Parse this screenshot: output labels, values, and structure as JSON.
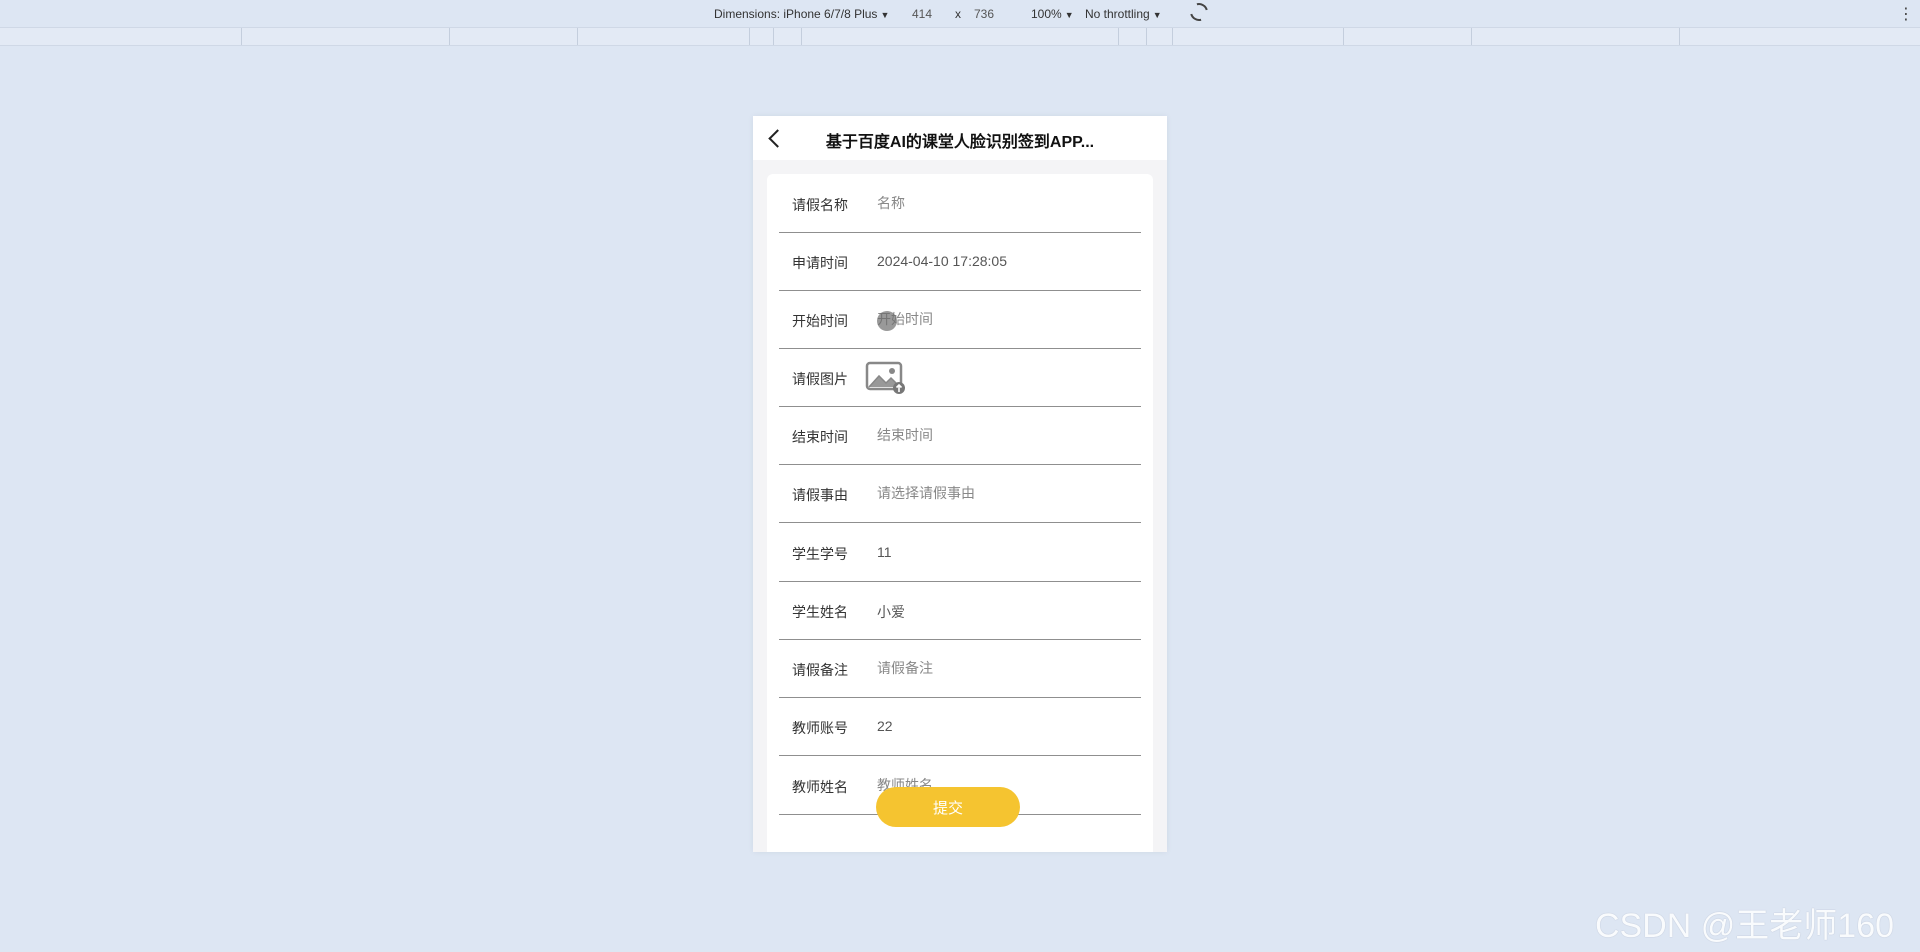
{
  "devtools": {
    "dimensions_label": "Dimensions: iPhone 6/7/8 Plus",
    "width": "414",
    "times": "x",
    "height": "736",
    "zoom": "100%",
    "throttling": "No throttling"
  },
  "app": {
    "title": "基于百度AI的课堂人脸识别签到APP...",
    "form": {
      "rows": [
        {
          "label": "请假名称",
          "value": "",
          "placeholder": "名称"
        },
        {
          "label": "申请时间",
          "value": "2024-04-10 17:28:05",
          "placeholder": ""
        },
        {
          "label": "开始时间",
          "value": "",
          "placeholder": "开始时间"
        },
        {
          "label": "请假图片",
          "icon": "image-upload-icon"
        },
        {
          "label": "结束时间",
          "value": "",
          "placeholder": "结束时间"
        },
        {
          "label": "请假事由",
          "value": "",
          "placeholder": "请选择请假事由"
        },
        {
          "label": "学生学号",
          "value": "11",
          "placeholder": ""
        },
        {
          "label": "学生姓名",
          "value": "小爱",
          "placeholder": ""
        },
        {
          "label": "请假备注",
          "value": "",
          "placeholder": "请假备注"
        },
        {
          "label": "教师账号",
          "value": "22",
          "placeholder": ""
        },
        {
          "label": "教师姓名",
          "value": "",
          "placeholder": "教师姓名"
        }
      ],
      "submit_label": "提交"
    }
  },
  "watermark": "CSDN @王老师160",
  "colors": {
    "background": "#dde6f3",
    "accent": "#f5c430",
    "divider": "#8f8f8f"
  }
}
